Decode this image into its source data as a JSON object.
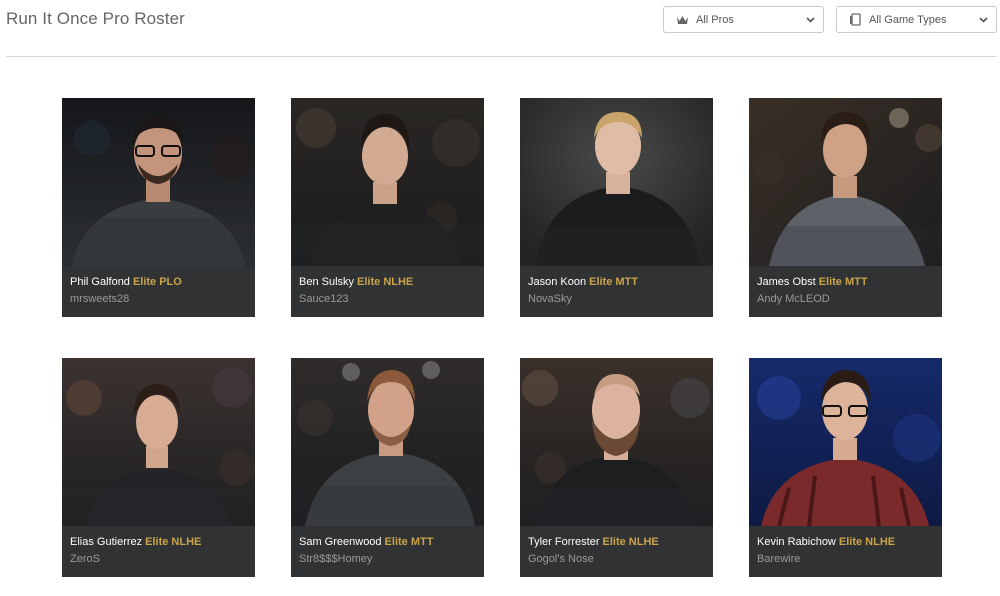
{
  "header": {
    "title": "Run It Once Pro Roster",
    "filters": {
      "pros": {
        "label": "All Pros",
        "icon": "crown-icon"
      },
      "game_types": {
        "label": "All Game Types",
        "icon": "cards-icon"
      }
    }
  },
  "pros": [
    {
      "name": "Phil Galfond",
      "badge": "Elite PLO",
      "nickname": "mrsweets28"
    },
    {
      "name": "Ben Sulsky",
      "badge": "Elite NLHE",
      "nickname": "Sauce123"
    },
    {
      "name": "Jason Koon",
      "badge": "Elite MTT",
      "nickname": "NovaSky"
    },
    {
      "name": "James Obst",
      "badge": "Elite MTT",
      "nickname": "Andy McLEOD"
    },
    {
      "name": "Elias Gutierrez",
      "badge": "Elite NLHE",
      "nickname": "ZeroS"
    },
    {
      "name": "Sam Greenwood",
      "badge": "Elite MTT",
      "nickname": "Str8$$$Homey"
    },
    {
      "name": "Tyler Forrester",
      "badge": "Elite NLHE",
      "nickname": "Gogol's Nose"
    },
    {
      "name": "Kevin Rabichow",
      "badge": "Elite NLHE",
      "nickname": "Barewire"
    }
  ],
  "colors": {
    "badge_gold": "#c9a44a",
    "card_info_bg": "#303234"
  }
}
